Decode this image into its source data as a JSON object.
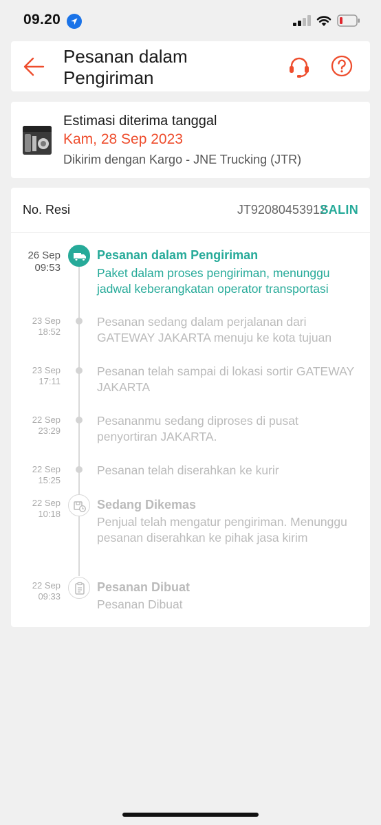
{
  "status_bar": {
    "time": "09.20"
  },
  "header": {
    "title": "Pesanan dalam Pengiriman"
  },
  "estimate": {
    "label": "Estimasi diterima tanggal",
    "date": "Kam, 28 Sep 2023",
    "courier": "Dikirim dengan Kargo - JNE Trucking (JTR)"
  },
  "tracking": {
    "resi_label": "No. Resi",
    "resi_number": "JT92080453912",
    "copy_label": "SALIN",
    "events": [
      {
        "date": "26 Sep",
        "time": "09:53",
        "title": "Pesanan dalam Pengiriman",
        "desc": "Paket dalam proses pengiriman, menunggu jadwal keberangkatan operator transportasi",
        "icon": "truck-icon",
        "active": true
      },
      {
        "date": "23 Sep",
        "time": "18:52",
        "title": "",
        "desc": "Pesanan sedang dalam perjalanan dari GATEWAY JAKARTA menuju ke kota tujuan",
        "icon": "dot",
        "active": false
      },
      {
        "date": "23 Sep",
        "time": "17:11",
        "title": "",
        "desc": "Pesanan telah sampai di lokasi sortir GATEWAY JAKARTA",
        "icon": "dot",
        "active": false
      },
      {
        "date": "22 Sep",
        "time": "23:29",
        "title": "",
        "desc": "Pesananmu sedang diproses di pusat penyortiran JAKARTA.",
        "icon": "dot",
        "active": false
      },
      {
        "date": "22 Sep",
        "time": "15:25",
        "title": "",
        "desc": "Pesanan telah diserahkan ke kurir",
        "icon": "dot",
        "active": false
      },
      {
        "date": "22 Sep",
        "time": "10:18",
        "title": "Sedang Dikemas",
        "desc": "Penjual telah mengatur pengiriman. Menunggu pesanan diserahkan ke pihak jasa kirim",
        "icon": "package-clock-icon",
        "active": false
      },
      {
        "date": "22 Sep",
        "time": "09:33",
        "title": "Pesanan Dibuat",
        "desc": "Pesanan Dibuat",
        "icon": "clipboard-icon",
        "active": false
      }
    ]
  },
  "colors": {
    "brand": "#ee4d2d",
    "accent": "#26aa99",
    "muted": "#bbbbbb"
  }
}
